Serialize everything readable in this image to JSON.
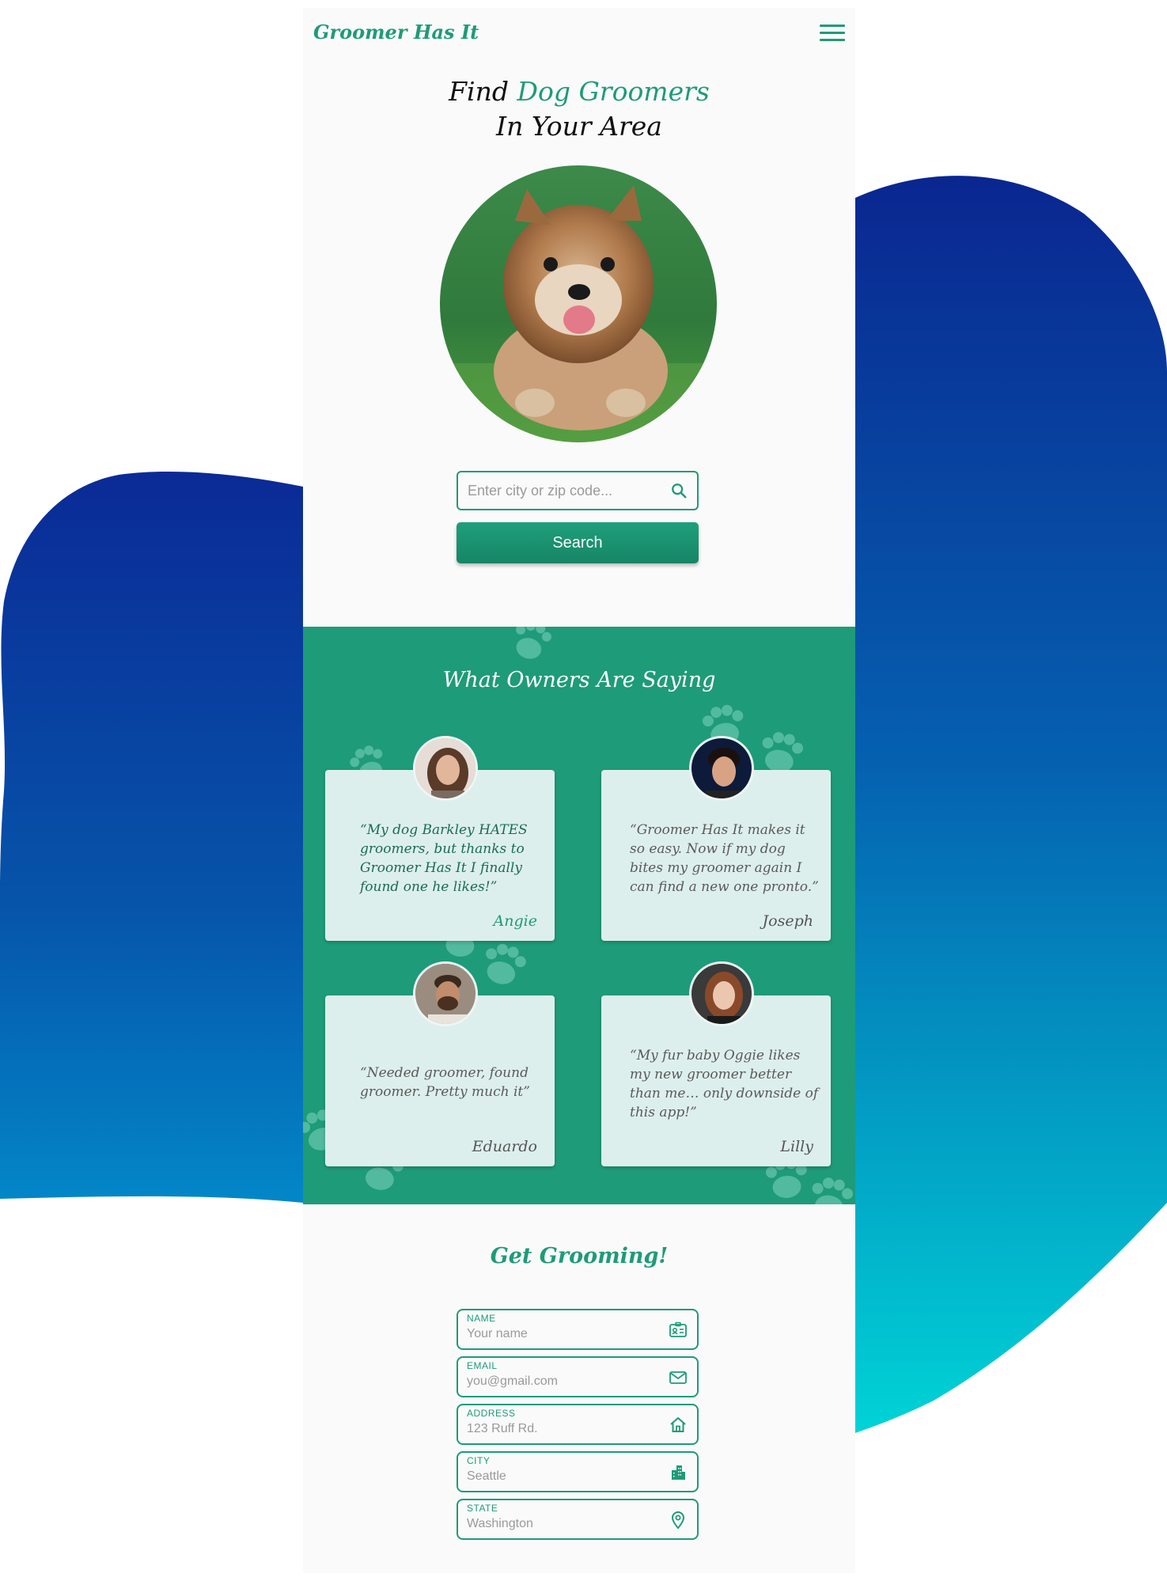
{
  "app": {
    "brand": "Groomer Has It",
    "menu_icon": "hamburger-menu-icon"
  },
  "hero": {
    "title_line1_prefix": "Find",
    "title_line1_accent": "Dog Groomers",
    "title_line2": "In Your Area",
    "photo": "puppy-photo"
  },
  "search": {
    "placeholder": "Enter city or zip code...",
    "icon": "search-icon",
    "button_label": "Search"
  },
  "testimonials": {
    "title": "What Owners Are Saying",
    "items": [
      {
        "quote": "“My dog Barkley HATES groomers, but thanks to Groomer Has It I finally found one he likes!”",
        "author": "Angie"
      },
      {
        "quote": "“Groomer Has It makes it so easy. Now if my dog bites my groomer again I can find a new one pronto.”",
        "author": "Joseph"
      },
      {
        "quote": "“Needed groomer, found groomer. Pretty much it”",
        "author": "Eduardo"
      },
      {
        "quote": "“My fur baby Oggie likes my new groomer better than me… only downside of this app!”",
        "author": "Lilly"
      }
    ]
  },
  "form": {
    "title": "Get Grooming!",
    "fields": [
      {
        "label": "NAME",
        "placeholder": "Your name",
        "icon": "id-card-icon"
      },
      {
        "label": "EMAIL",
        "placeholder": "you@gmail.com",
        "icon": "envelope-icon"
      },
      {
        "label": "ADDRESS",
        "placeholder": "123 Ruff Rd.",
        "icon": "home-icon"
      },
      {
        "label": "CITY",
        "placeholder": "Seattle",
        "icon": "city-buildings-icon"
      },
      {
        "label": "STATE",
        "placeholder": "Washington",
        "icon": "location-pin-icon"
      }
    ]
  },
  "colors": {
    "brand_green": "#1e9b79",
    "card_bg": "#ddefec",
    "blob_dark_blue": "#0a2a9a",
    "blob_cyan": "#00d4d6"
  }
}
